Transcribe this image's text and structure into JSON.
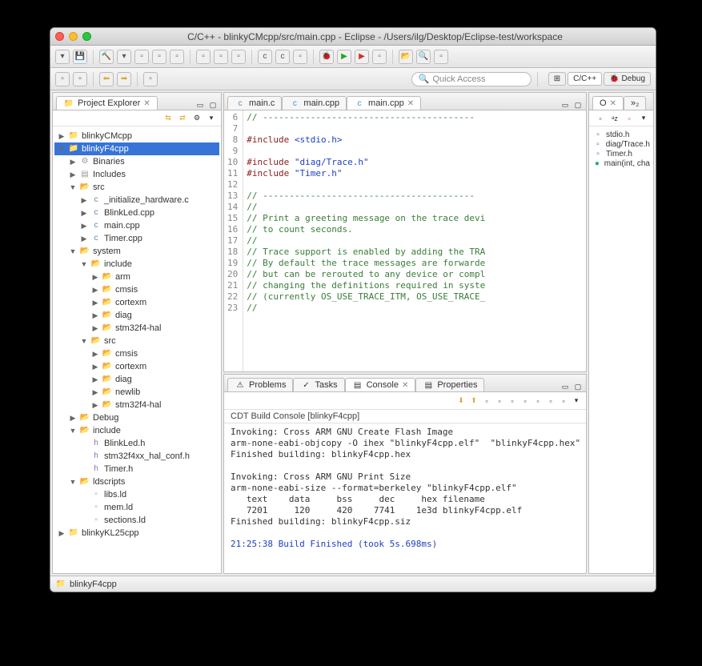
{
  "window": {
    "title": "C/C++ - blinkyCMcpp/src/main.cpp - Eclipse - /Users/ilg/Desktop/Eclipse-test/workspace"
  },
  "quick_access": {
    "placeholder": "Quick Access"
  },
  "perspectives": {
    "cpp": "C/C++",
    "debug": "Debug"
  },
  "project_explorer": {
    "title": "Project Explorer",
    "tree": [
      {
        "d": 0,
        "e": "▶",
        "i": "proj",
        "t": "blinkyCMcpp"
      },
      {
        "d": 0,
        "e": "▼",
        "i": "proj",
        "t": "blinkyF4cpp",
        "sel": true
      },
      {
        "d": 1,
        "e": "▶",
        "i": "bin",
        "t": "Binaries"
      },
      {
        "d": 1,
        "e": "▶",
        "i": "inc",
        "t": "Includes"
      },
      {
        "d": 1,
        "e": "▼",
        "i": "folder",
        "t": "src"
      },
      {
        "d": 2,
        "e": "▶",
        "i": "c",
        "t": "_initialize_hardware.c"
      },
      {
        "d": 2,
        "e": "▶",
        "i": "c",
        "t": "BlinkLed.cpp"
      },
      {
        "d": 2,
        "e": "▶",
        "i": "c",
        "t": "main.cpp"
      },
      {
        "d": 2,
        "e": "▶",
        "i": "c",
        "t": "Timer.cpp"
      },
      {
        "d": 1,
        "e": "▼",
        "i": "folder",
        "t": "system"
      },
      {
        "d": 2,
        "e": "▼",
        "i": "folder",
        "t": "include"
      },
      {
        "d": 3,
        "e": "▶",
        "i": "folder",
        "t": "arm"
      },
      {
        "d": 3,
        "e": "▶",
        "i": "folder",
        "t": "cmsis"
      },
      {
        "d": 3,
        "e": "▶",
        "i": "folder",
        "t": "cortexm"
      },
      {
        "d": 3,
        "e": "▶",
        "i": "folder",
        "t": "diag"
      },
      {
        "d": 3,
        "e": "▶",
        "i": "folder",
        "t": "stm32f4-hal"
      },
      {
        "d": 2,
        "e": "▼",
        "i": "folder",
        "t": "src"
      },
      {
        "d": 3,
        "e": "▶",
        "i": "folder",
        "t": "cmsis"
      },
      {
        "d": 3,
        "e": "▶",
        "i": "folder",
        "t": "cortexm"
      },
      {
        "d": 3,
        "e": "▶",
        "i": "folder",
        "t": "diag"
      },
      {
        "d": 3,
        "e": "▶",
        "i": "folder",
        "t": "newlib"
      },
      {
        "d": 3,
        "e": "▶",
        "i": "folder",
        "t": "stm32f4-hal"
      },
      {
        "d": 1,
        "e": "▶",
        "i": "folder",
        "t": "Debug"
      },
      {
        "d": 1,
        "e": "▼",
        "i": "folder",
        "t": "include"
      },
      {
        "d": 2,
        "e": "",
        "i": "h",
        "t": "BlinkLed.h"
      },
      {
        "d": 2,
        "e": "",
        "i": "h",
        "t": "stm32f4xx_hal_conf.h"
      },
      {
        "d": 2,
        "e": "",
        "i": "h",
        "t": "Timer.h"
      },
      {
        "d": 1,
        "e": "▼",
        "i": "folder",
        "t": "ldscripts"
      },
      {
        "d": 2,
        "e": "",
        "i": "ld",
        "t": "libs.ld"
      },
      {
        "d": 2,
        "e": "",
        "i": "ld",
        "t": "mem.ld"
      },
      {
        "d": 2,
        "e": "",
        "i": "ld",
        "t": "sections.ld"
      },
      {
        "d": 0,
        "e": "▶",
        "i": "proj",
        "t": "blinkyKL25cpp"
      }
    ]
  },
  "editor": {
    "tabs": [
      {
        "label": "main.c",
        "active": false
      },
      {
        "label": "main.cpp",
        "active": false
      },
      {
        "label": "main.cpp",
        "active": true
      }
    ],
    "lines": [
      {
        "n": "6",
        "cls": "c-comment",
        "t": "// ----------------------------------------"
      },
      {
        "n": "7",
        "cls": "",
        "t": ""
      },
      {
        "n": "8",
        "cls": "",
        "t": "#include <stdio.h>",
        "html": "<span class='c-inc'>#include</span> <span class='c-str'>&lt;stdio.h&gt;</span>"
      },
      {
        "n": "9",
        "cls": "",
        "t": ""
      },
      {
        "n": "10",
        "cls": "",
        "t": "#include \"diag/Trace.h\"",
        "html": "<span class='c-inc'>#include</span> <span class='c-str'>\"diag/Trace.h\"</span>"
      },
      {
        "n": "11",
        "cls": "",
        "t": "#include \"Timer.h\"",
        "html": "<span class='c-inc'>#include</span> <span class='c-str'>\"Timer.h\"</span>"
      },
      {
        "n": "12",
        "cls": "",
        "t": ""
      },
      {
        "n": "13",
        "cls": "c-comment",
        "t": "// ----------------------------------------"
      },
      {
        "n": "14",
        "cls": "c-comment",
        "t": "//"
      },
      {
        "n": "15",
        "cls": "c-comment",
        "t": "// Print a greeting message on the trace devi"
      },
      {
        "n": "16",
        "cls": "c-comment",
        "t": "// to count seconds."
      },
      {
        "n": "17",
        "cls": "c-comment",
        "t": "//"
      },
      {
        "n": "18",
        "cls": "c-comment",
        "t": "// Trace support is enabled by adding the TRA"
      },
      {
        "n": "19",
        "cls": "c-comment",
        "t": "// By default the trace messages are forwarde"
      },
      {
        "n": "20",
        "cls": "c-comment",
        "t": "// but can be rerouted to any device or compl"
      },
      {
        "n": "21",
        "cls": "c-comment",
        "t": "// changing the definitions required in syste"
      },
      {
        "n": "22",
        "cls": "c-comment",
        "t": "// (currently OS_USE_TRACE_ITM, OS_USE_TRACE_"
      },
      {
        "n": "23",
        "cls": "c-comment",
        "t": "//"
      }
    ]
  },
  "outline": {
    "tab1": "O",
    "tab2": "»₂",
    "items": [
      {
        "i": "h",
        "t": "stdio.h"
      },
      {
        "i": "h",
        "t": "diag/Trace.h"
      },
      {
        "i": "h",
        "t": "Timer.h"
      },
      {
        "i": "m",
        "t": "main(int, cha"
      }
    ]
  },
  "bottom_tabs": {
    "problems": "Problems",
    "tasks": "Tasks",
    "console": "Console",
    "properties": "Properties"
  },
  "console": {
    "title": "CDT Build Console [blinkyF4cpp]",
    "body": "Invoking: Cross ARM GNU Create Flash Image\narm-none-eabi-objcopy -O ihex \"blinkyF4cpp.elf\"  \"blinkyF4cpp.hex\"\nFinished building: blinkyF4cpp.hex\n \nInvoking: Cross ARM GNU Print Size\narm-none-eabi-size --format=berkeley \"blinkyF4cpp.elf\"\n   text\t   data\t    bss\t    dec\t    hex\tfilename\n   7201\t    120\t    420\t   7741\t   1e3d\tblinkyF4cpp.elf\nFinished building: blinkyF4cpp.siz\n ",
    "done": "21:25:38 Build Finished (took 5s.698ms)"
  },
  "statusbar": {
    "project": "blinkyF4cpp"
  }
}
